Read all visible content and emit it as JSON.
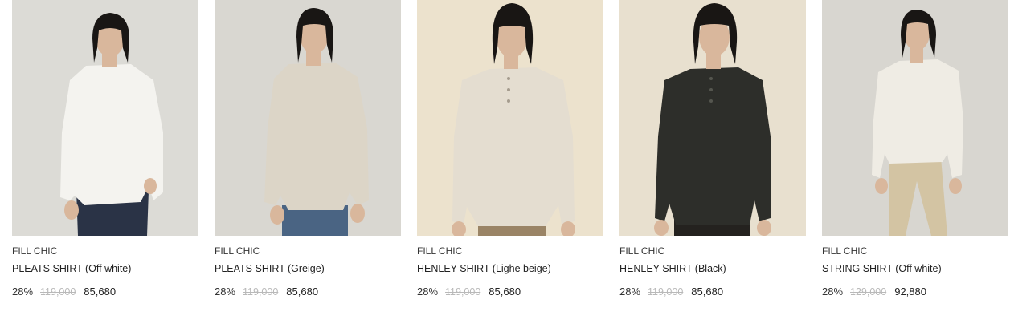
{
  "products": [
    {
      "brand": "FILL CHIC",
      "name": "PLEATS SHIRT (Off white)",
      "discount": "28%",
      "original_price": "119,000",
      "sale_price": "85,680",
      "colors": {
        "bg": "#dcdbd6",
        "top": "#f4f3ef",
        "bottom": "#2a3346",
        "hair": "#191614"
      }
    },
    {
      "brand": "FILL CHIC",
      "name": "PLEATS SHIRT (Greige)",
      "discount": "28%",
      "original_price": "119,000",
      "sale_price": "85,680",
      "colors": {
        "bg": "#d9d7d1",
        "top": "#dcd5c7",
        "bottom": "#4a6483",
        "hair": "#191614"
      }
    },
    {
      "brand": "FILL CHIC",
      "name": "HENLEY SHIRT (Lighe beige)",
      "discount": "28%",
      "original_price": "119,000",
      "sale_price": "85,680",
      "colors": {
        "bg": "#ece2cd",
        "top": "#e4ddd0",
        "bottom": "#9a8466",
        "hair": "#191614"
      }
    },
    {
      "brand": "FILL CHIC",
      "name": "HENLEY SHIRT (Black)",
      "discount": "28%",
      "original_price": "119,000",
      "sale_price": "85,680",
      "colors": {
        "bg": "#e8e0cf",
        "top": "#2d2e2a",
        "bottom": "#24221f",
        "hair": "#191614"
      }
    },
    {
      "brand": "FILL CHIC",
      "name": "STRING SHIRT (Off white)",
      "discount": "28%",
      "original_price": "129,000",
      "sale_price": "92,880",
      "colors": {
        "bg": "#d8d6d0",
        "top": "#efece4",
        "bottom": "#d3c4a3",
        "hair": "#191614"
      }
    }
  ]
}
